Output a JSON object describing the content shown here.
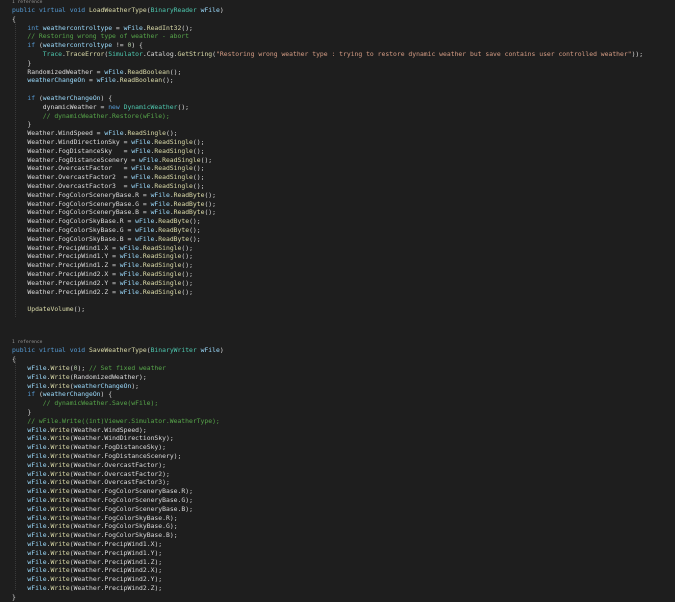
{
  "colors": {
    "background": "#1e1e1e",
    "keyword": "#569cd6",
    "type": "#4ec9b0",
    "method": "#dcdcaa",
    "variable": "#9cdcfe",
    "string": "#d69d85",
    "comment": "#57a64a",
    "number": "#b5cea8",
    "plain": "#dcdcdc",
    "reference": "#999999"
  },
  "lines": [
    {
      "ref": "1 reference"
    },
    {
      "code": "public virtual void LoadWeatherType(BinaryReader wFile)"
    },
    {
      "code": "{"
    },
    {
      "code": "    int weathercontroltype = wFile.ReadInt32();"
    },
    {
      "code": "    // Restoring wrong type of weather - abort"
    },
    {
      "code": "    if (weathercontroltype != 0) {"
    },
    {
      "code": "        Trace.TraceError(Simulator.Catalog.GetString(\"Restoring wrong weather type : trying to restore dynamic weather but save contains user controlled weather\"));"
    },
    {
      "code": "    }"
    },
    {
      "code": "    RandomizedWeather = wFile.ReadBoolean();"
    },
    {
      "code": "    weatherChangeOn = wFile.ReadBoolean();"
    },
    {
      "code": ""
    },
    {
      "code": "    if (weatherChangeOn) {"
    },
    {
      "code": "        dynamicWeather = new DynamicWeather();"
    },
    {
      "code": "        // dynamicWeather.Restore(wFile);"
    },
    {
      "code": "    }"
    },
    {
      "code": "    Weather.WindSpeed = wFile.ReadSingle();"
    },
    {
      "code": "    Weather.WindDirectionSky = wFile.ReadSingle();"
    },
    {
      "code": "    Weather.FogDistanceSky   = wFile.ReadSingle();"
    },
    {
      "code": "    Weather.FogDistanceScenery = wFile.ReadSingle();"
    },
    {
      "code": "    Weather.OvercastFactor   = wFile.ReadSingle();"
    },
    {
      "code": "    Weather.OvercastFactor2  = wFile.ReadSingle();"
    },
    {
      "code": "    Weather.OvercastFactor3  = wFile.ReadSingle();"
    },
    {
      "code": "    Weather.FogColorSceneryBase.R = wFile.ReadByte();"
    },
    {
      "code": "    Weather.FogColorSceneryBase.G = wFile.ReadByte();"
    },
    {
      "code": "    Weather.FogColorSceneryBase.B = wFile.ReadByte();"
    },
    {
      "code": "    Weather.FogColorSkyBase.R = wFile.ReadByte();"
    },
    {
      "code": "    Weather.FogColorSkyBase.G = wFile.ReadByte();"
    },
    {
      "code": "    Weather.FogColorSkyBase.B = wFile.ReadByte();"
    },
    {
      "code": "    Weather.PrecipWind1.X = wFile.ReadSingle();"
    },
    {
      "code": "    Weather.PrecipWind1.Y = wFile.ReadSingle();"
    },
    {
      "code": "    Weather.PrecipWind1.Z = wFile.ReadSingle();"
    },
    {
      "code": "    Weather.PrecipWind2.X = wFile.ReadSingle();"
    },
    {
      "code": "    Weather.PrecipWind2.Y = wFile.ReadSingle();"
    },
    {
      "code": "    Weather.PrecipWind2.Z = wFile.ReadSingle();"
    },
    {
      "code": ""
    },
    {
      "code": "    UpdateVolume();"
    },
    {
      "code": ""
    },
    {
      "code": ""
    },
    {
      "code": ""
    },
    {
      "ref": "1 reference"
    },
    {
      "code": "public virtual void SaveWeatherType(BinaryWriter wFile)"
    },
    {
      "code": "{"
    },
    {
      "code": "    wFile.Write(0); // Set fixed weather"
    },
    {
      "code": "    wFile.Write(RandomizedWeather);"
    },
    {
      "code": "    wFile.Write(weatherChangeOn);"
    },
    {
      "code": "    if (weatherChangeOn) {"
    },
    {
      "code": "        // dynamicWeather.Save(wFile);"
    },
    {
      "code": "    }"
    },
    {
      "code": "    // wFile.Write((int)Viewer.Simulator.WeatherType);"
    },
    {
      "code": "    wFile.Write(Weather.WindSpeed);"
    },
    {
      "code": "    wFile.Write(Weather.WindDirectionSky);"
    },
    {
      "code": "    wFile.Write(Weather.FogDistanceSky);"
    },
    {
      "code": "    wFile.Write(Weather.FogDistanceScenery);"
    },
    {
      "code": "    wFile.Write(Weather.OvercastFactor);"
    },
    {
      "code": "    wFile.Write(Weather.OvercastFactor2);"
    },
    {
      "code": "    wFile.Write(Weather.OvercastFactor3);"
    },
    {
      "code": "    wFile.Write(Weather.FogColorSceneryBase.R);"
    },
    {
      "code": "    wFile.Write(Weather.FogColorSceneryBase.G);"
    },
    {
      "code": "    wFile.Write(Weather.FogColorSceneryBase.B);"
    },
    {
      "code": "    wFile.Write(Weather.FogColorSkyBase.R);"
    },
    {
      "code": "    wFile.Write(Weather.FogColorSkyBase.G);"
    },
    {
      "code": "    wFile.Write(Weather.FogColorSkyBase.B);"
    },
    {
      "code": "    wFile.Write(Weather.PrecipWind1.X);"
    },
    {
      "code": "    wFile.Write(Weather.PrecipWind1.Y);"
    },
    {
      "code": "    wFile.Write(Weather.PrecipWind1.Z);"
    },
    {
      "code": "    wFile.Write(Weather.PrecipWind2.X);"
    },
    {
      "code": "    wFile.Write(Weather.PrecipWind2.Y);"
    },
    {
      "code": "    wFile.Write(Weather.PrecipWind2.Z);"
    },
    {
      "code": "}"
    }
  ]
}
